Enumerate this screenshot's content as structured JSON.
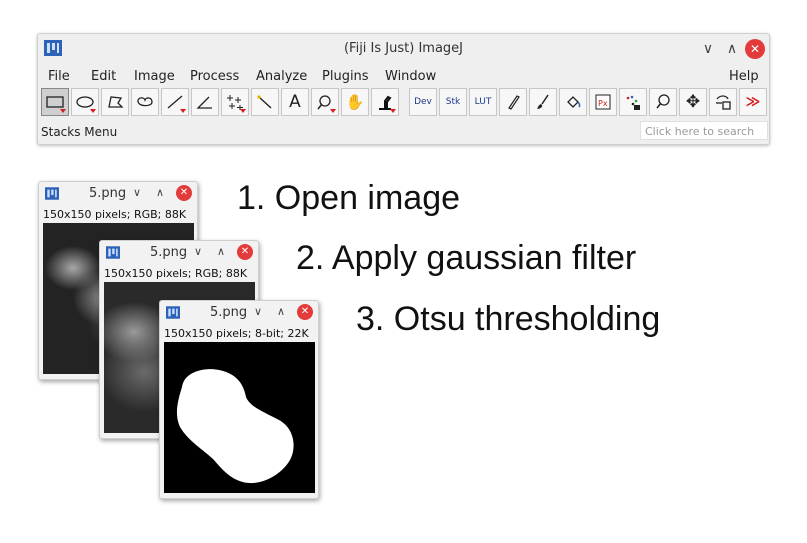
{
  "main_window": {
    "title": "(Fiji Is Just) ImageJ",
    "controls": [
      "∨",
      "∧",
      "✕"
    ],
    "menu": [
      "File",
      "Edit",
      "Image",
      "Process",
      "Analyze",
      "Plugins",
      "Window",
      "Help"
    ],
    "toolbar_text": {
      "dev": "Dev",
      "stk": "Stk",
      "lut": "LUT"
    },
    "status": "Stacks Menu",
    "search_placeholder": "Click here to search"
  },
  "image_windows": [
    {
      "title": "5.png",
      "info": "150x150 pixels; RGB; 88K",
      "controls": [
        "∨",
        "∧",
        "✕"
      ]
    },
    {
      "title": "5.png",
      "info": "150x150 pixels; RGB; 88K",
      "controls": [
        "∨",
        "∧",
        "✕"
      ]
    },
    {
      "title": "5.png",
      "info": "150x150 pixels; 8-bit; 22K",
      "controls": [
        "∨",
        "∧",
        "✕"
      ]
    }
  ],
  "steps": [
    "1. Open image",
    "2. Apply gaussian filter",
    "3. Otsu thresholding"
  ],
  "colors": {
    "close_button": "#e33b3b",
    "logo_blue": "#2c62b8",
    "dropdown_marker": "#d21f1f"
  }
}
